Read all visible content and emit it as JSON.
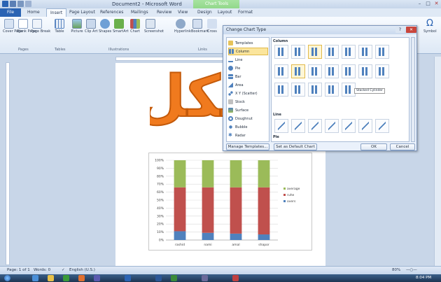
{
  "app": {
    "title": "Document2 - Microsoft Word",
    "chart_tools": "Chart Tools"
  },
  "ribbon": {
    "tabs": [
      "File",
      "Home",
      "Insert",
      "Page Layout",
      "References",
      "Mailings",
      "Review",
      "View",
      "Design",
      "Layout",
      "Format"
    ],
    "buttons": [
      "Cover Page",
      "Blank Page",
      "Page Break",
      "Table",
      "Picture",
      "Clip Art",
      "Shapes",
      "SmartArt",
      "Chart",
      "Screenshot",
      "Hyperlink",
      "Bookmark",
      "Cross"
    ],
    "groups": [
      "Pages",
      "Tables",
      "Illustrations",
      "Links"
    ],
    "right_button": "Symbol"
  },
  "dialog": {
    "title": "Change Chart Type",
    "chart_types": [
      "Templates",
      "Column",
      "Line",
      "Pie",
      "Bar",
      "Area",
      "X Y (Scatter)",
      "Stock",
      "Surface",
      "Doughnut",
      "Bubble",
      "Radar"
    ],
    "selected_type": "Column",
    "sections": [
      "Column",
      "Line",
      "Pie"
    ],
    "tooltip": "Stacked Cylinder",
    "manage_templates": "Manage Templates...",
    "set_default": "Set as Default Chart",
    "ok": "OK",
    "cancel": "Cancel"
  },
  "overlay": {
    "text": "٥ شكل",
    "color": "#f07a1e"
  },
  "chart_data": {
    "type": "bar",
    "stacked": "percent",
    "categories": [
      "rashid",
      "nami",
      "amal",
      "shapor"
    ],
    "series": [
      {
        "name": "overs",
        "values": [
          11,
          9,
          8,
          7
        ],
        "color": "#4f81bd"
      },
      {
        "name": "ruhe",
        "values": [
          55,
          57,
          58,
          59
        ],
        "color": "#c0504d"
      },
      {
        "name": "average",
        "values": [
          34,
          34,
          34,
          34
        ],
        "color": "#9bbb59"
      }
    ],
    "y_ticks": [
      "0%",
      "10%",
      "20%",
      "30%",
      "40%",
      "50%",
      "60%",
      "70%",
      "80%",
      "90%",
      "100%"
    ],
    "ylim": [
      0,
      100
    ],
    "grid": true,
    "legend": "right"
  },
  "status": {
    "page": "Page: 1 of 1",
    "words": "Words: 0",
    "language": "English (U.S.)",
    "zoom": "80%"
  },
  "clock": "8:04 PM"
}
